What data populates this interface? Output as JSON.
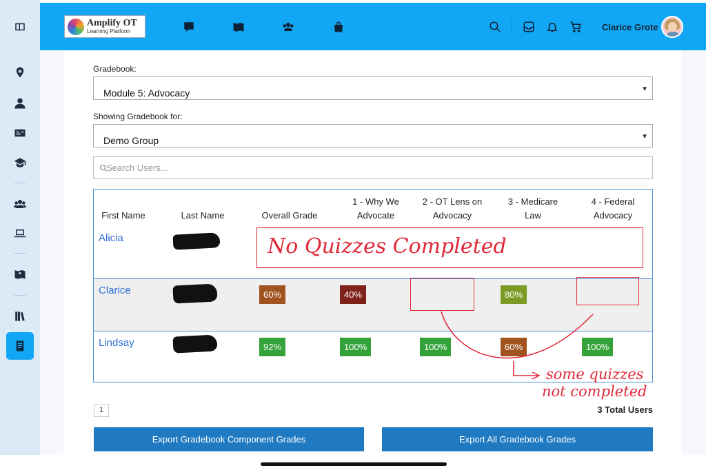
{
  "app": {
    "logo_title": "Amplify OT",
    "logo_sub": "Learning Platform",
    "user_name": "Clarice Grote"
  },
  "form": {
    "gradebook_label": "Gradebook:",
    "gradebook_value": "Module 5: Advocacy",
    "group_label": "Showing Gradebook for:",
    "group_value": "Demo Group",
    "search_placeholder": "Search Users..."
  },
  "table": {
    "headers": [
      "First Name",
      "Last Name",
      "Overall Grade",
      "1 - Why We Advocate",
      "2 - OT Lens on Advocacy",
      "3 - Medicare Law",
      "4 - Federal Advocacy"
    ],
    "rows": [
      {
        "first": "Alicia",
        "grades": []
      },
      {
        "first": "Clarice",
        "grades": [
          "60%",
          "40%",
          "",
          "80%",
          ""
        ]
      },
      {
        "first": "Lindsay",
        "grades": [
          "92%",
          "100%",
          "100%",
          "60%",
          "100%"
        ]
      }
    ]
  },
  "colors": {
    "green": "#35a33a",
    "olive": "#7c9b24",
    "brown": "#a0521f",
    "darkred": "#7e2119",
    "accent": "#12a7f5",
    "annotation": "#e02838"
  },
  "annotations": {
    "no_quizzes": "No Quizzes Completed",
    "some_quizzes_1": "some quizzes",
    "some_quizzes_2": "not completed"
  },
  "footer": {
    "page": "1",
    "total": "3 Total Users",
    "export_component": "Export Gradebook Component Grades",
    "export_all": "Export All Gradebook Grades"
  }
}
